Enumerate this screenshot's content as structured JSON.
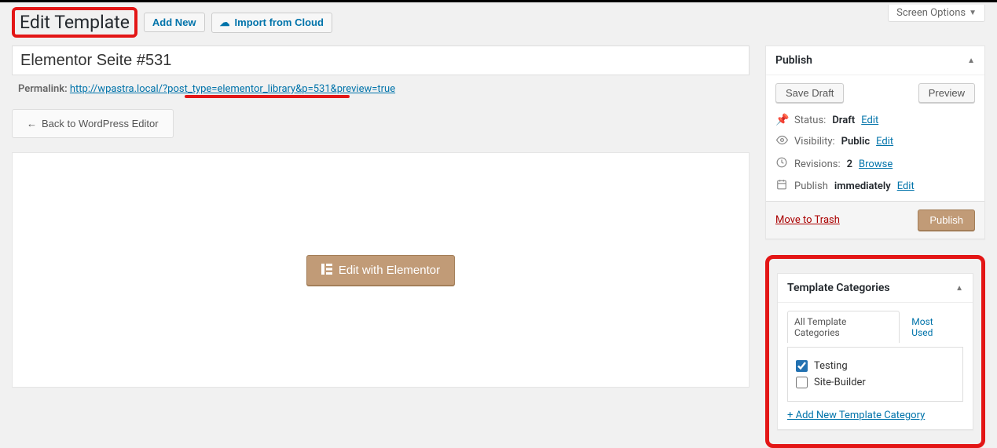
{
  "screen_options_label": "Screen Options",
  "page_title": "Edit Template",
  "header_buttons": {
    "add_new": "Add New",
    "import": "Import from Cloud"
  },
  "title_input_value": "Elementor Seite #531",
  "permalink": {
    "label": "Permalink:",
    "url": "http://wpastra.local/?post_type=elementor_library&p=531&preview=true"
  },
  "back_button": "Back to WordPress Editor",
  "elementor_button": "Edit with Elementor",
  "publish_box": {
    "title": "Publish",
    "save_draft": "Save Draft",
    "preview": "Preview",
    "status_label": "Status:",
    "status_value": "Draft",
    "visibility_label": "Visibility:",
    "visibility_value": "Public",
    "revisions_label": "Revisions:",
    "revisions_count": "2",
    "browse": "Browse",
    "publish_time_label": "Publish",
    "publish_time_value": "immediately",
    "edit": "Edit",
    "move_to_trash": "Move to Trash",
    "publish_button": "Publish"
  },
  "categories_box": {
    "title": "Template Categories",
    "tabs": {
      "all": "All Template Categories",
      "most_used": "Most Used"
    },
    "items": [
      {
        "label": "Testing",
        "checked": true
      },
      {
        "label": "Site-Builder",
        "checked": false
      }
    ],
    "add_new": "+ Add New Template Category"
  }
}
